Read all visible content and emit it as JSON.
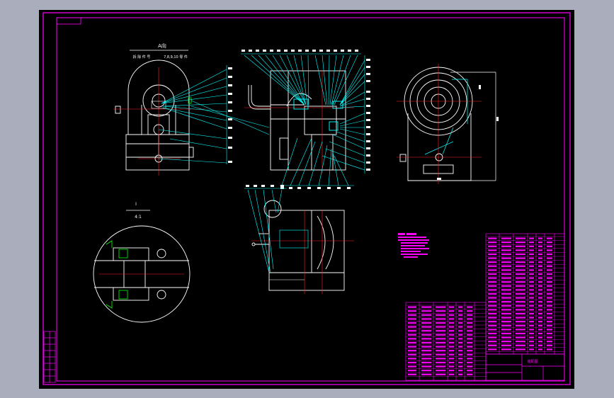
{
  "view_a_title": "A向",
  "view_a_sub_left": "拆 除 件 号",
  "view_a_sub_right": "7,8,9,10 零 件",
  "detail_title": "I",
  "detail_scale": "4:1",
  "title_block_label": "装配图",
  "colors": {
    "background": "#000000",
    "frame": "#ff00ff",
    "geometry": "#ffffff",
    "leader": "#00ffff",
    "center_line": "#ff0000",
    "outer_margin": "#a9adbc"
  }
}
